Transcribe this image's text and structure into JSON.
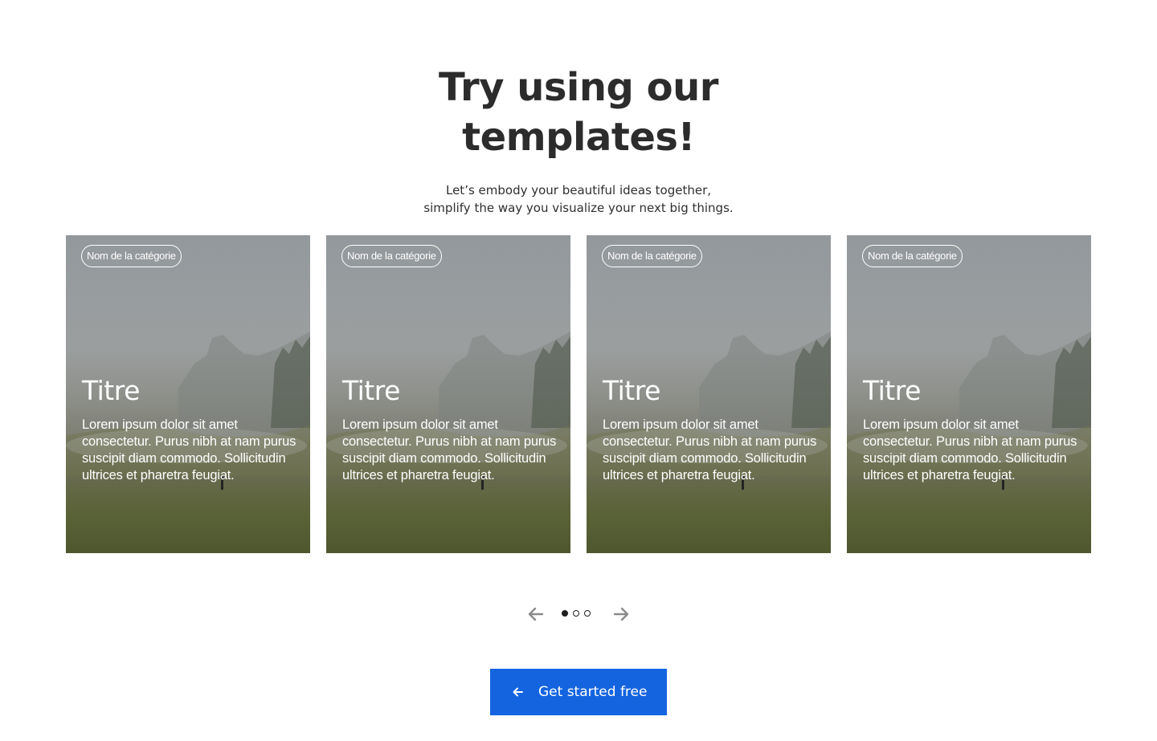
{
  "header": {
    "title_line1": "Try using our",
    "title_line2": "templates!",
    "subtitle_line1": "Let’s embody your beautiful ideas together,",
    "subtitle_line2": "simplify the way you visualize your next big things."
  },
  "cards": [
    {
      "category": "Nom de la catégorie",
      "title": "Titre",
      "body": "Lorem ipsum dolor sit amet consectetur. Purus nibh at nam purus suscipit diam commodo. Sollicitudin ultrices et pharetra feugiat."
    },
    {
      "category": "Nom de la catégorie",
      "title": "Titre",
      "body": "Lorem ipsum dolor sit amet consectetur. Purus nibh at nam purus suscipit diam commodo. Sollicitudin ultrices et pharetra feugiat."
    },
    {
      "category": "Nom de la catégorie",
      "title": "Titre",
      "body": "Lorem ipsum dolor sit amet consectetur. Purus nibh at nam purus suscipit diam commodo. Sollicitudin ultrices et pharetra feugiat."
    },
    {
      "category": "Nom de la catégorie",
      "title": "Titre",
      "body": "Lorem ipsum dolor sit amet consectetur. Purus nibh at nam purus suscipit diam commodo. Sollicitudin ultrices et pharetra feugiat."
    }
  ],
  "pager": {
    "prev_icon": "arrow-left-icon",
    "next_icon": "arrow-right-icon",
    "page_count": 3,
    "active_page": 1
  },
  "cta": {
    "label": "Get started free",
    "icon": "arrow-left-icon",
    "color": "#1464e0"
  }
}
